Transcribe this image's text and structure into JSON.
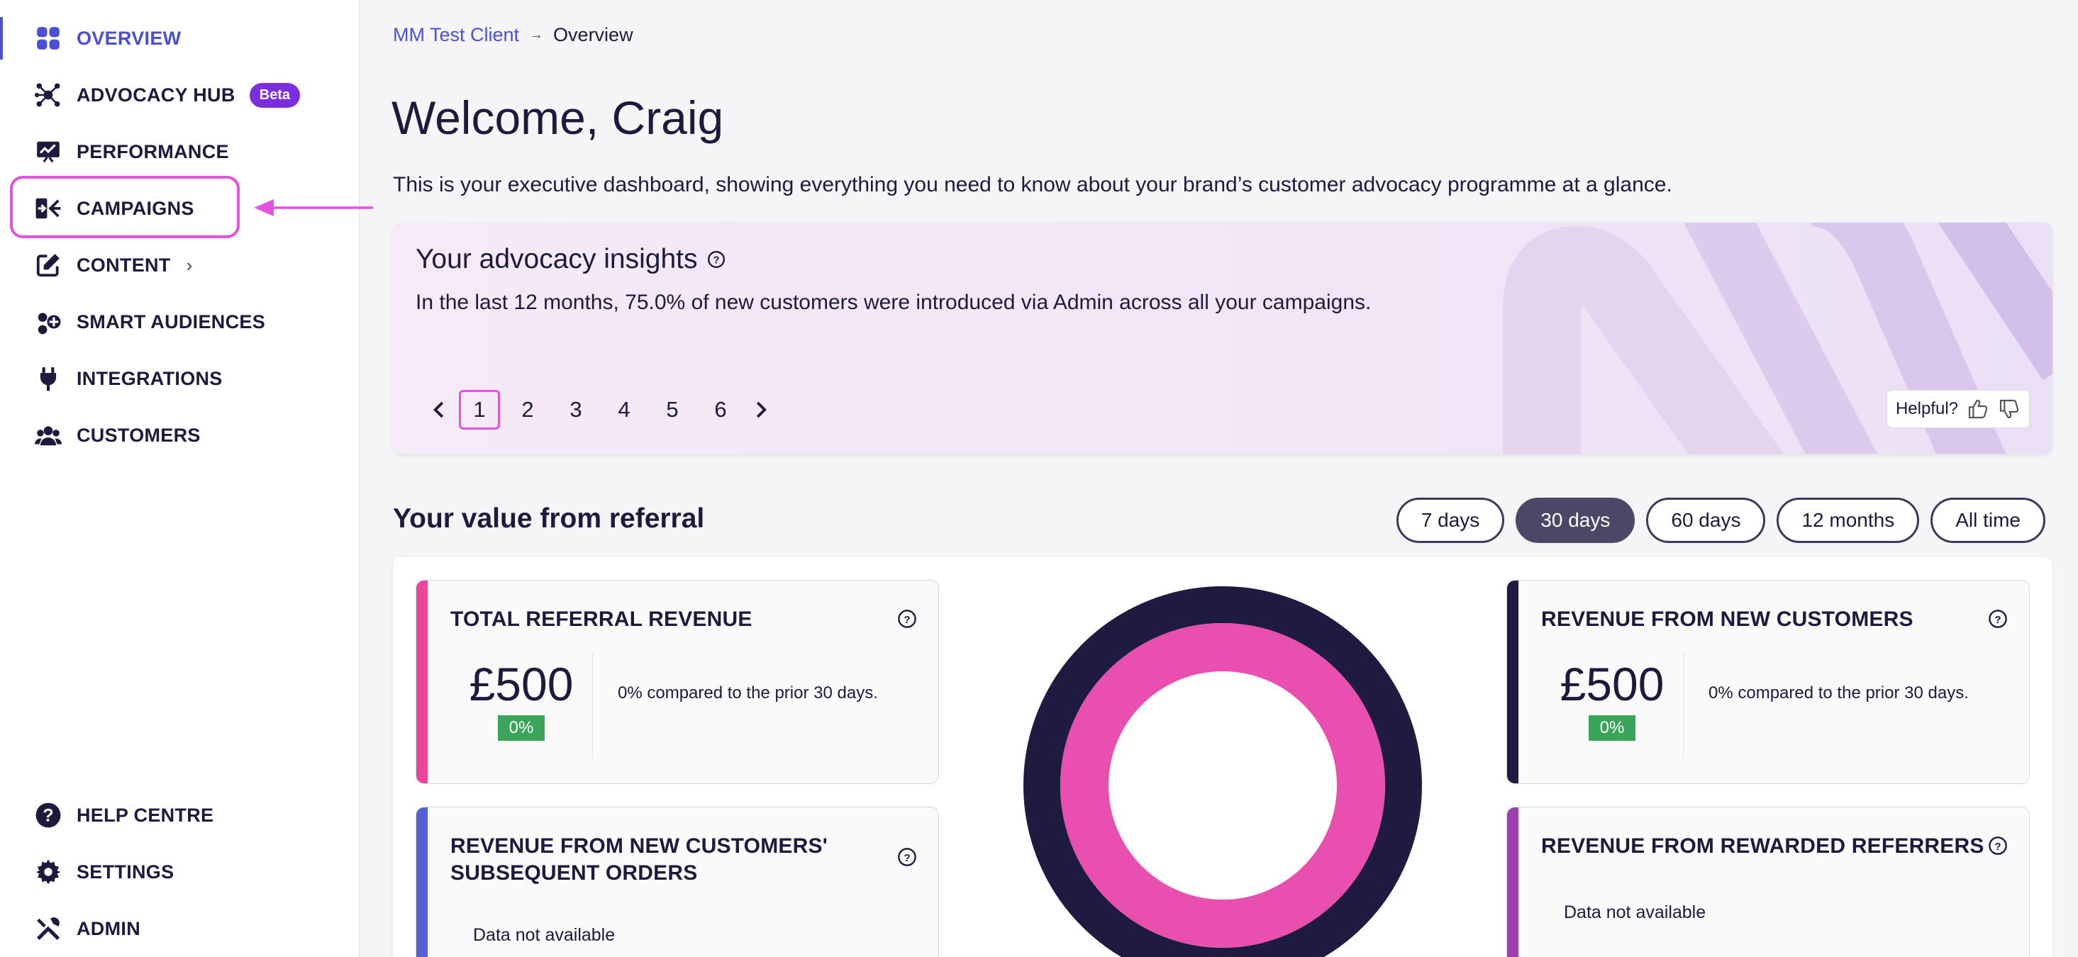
{
  "sidebar": {
    "items": [
      {
        "label": "OVERVIEW",
        "icon": "grid-icon"
      },
      {
        "label": "ADVOCACY HUB",
        "icon": "network-icon",
        "badge": "Beta"
      },
      {
        "label": "PERFORMANCE",
        "icon": "chart-icon"
      },
      {
        "label": "CAMPAIGNS",
        "icon": "campaigns-icon"
      },
      {
        "label": "CONTENT",
        "icon": "edit-icon"
      },
      {
        "label": "SMART AUDIENCES",
        "icon": "audience-icon"
      },
      {
        "label": "INTEGRATIONS",
        "icon": "plug-icon"
      },
      {
        "label": "CUSTOMERS",
        "icon": "users-icon"
      }
    ],
    "bottom_items": [
      {
        "label": "HELP CENTRE",
        "icon": "help-icon"
      },
      {
        "label": "SETTINGS",
        "icon": "gear-icon"
      },
      {
        "label": "ADMIN",
        "icon": "tools-icon"
      }
    ]
  },
  "breadcrumb": {
    "client": "MM Test Client",
    "current": "Overview"
  },
  "page": {
    "title": "Welcome, Craig",
    "intro": "This is your executive dashboard, showing everything you need to know about your brand’s customer advocacy programme at a glance."
  },
  "insights": {
    "title": "Your advocacy insights",
    "text": "In the last 12 months, 75.0% of new customers were introduced via Admin across all your campaigns.",
    "pages": [
      "1",
      "2",
      "3",
      "4",
      "5",
      "6"
    ],
    "current_page": "1",
    "helpful_label": "Helpful?"
  },
  "value": {
    "heading": "Your value from referral",
    "ranges": [
      "7 days",
      "30 days",
      "60 days",
      "12 months",
      "All time"
    ],
    "selected_range": "30 days"
  },
  "cards": {
    "total_revenue": {
      "title": "TOTAL REFERRAL REVENUE",
      "amount": "£500",
      "pct": "0%",
      "compare": "0% compared to the prior 30 days.",
      "color": "#e8459b"
    },
    "new_customers": {
      "title": "REVENUE FROM NEW CUSTOMERS",
      "amount": "£500",
      "pct": "0%",
      "compare": "0% compared to the prior 30 days.",
      "color": "#1e1a40"
    },
    "subsequent_orders": {
      "title_line1": "REVENUE FROM NEW CUSTOMERS'",
      "title_line2": "SUBSEQUENT ORDERS",
      "na": "Data not available",
      "color": "#5560d8"
    },
    "rewarded_referrers": {
      "title": "REVENUE FROM REWARDED REFERRERS",
      "na": "Data not available",
      "color": "#9b3fb0"
    }
  },
  "colors": {
    "accent": "#4b4fd6",
    "highlight": "#e452e0",
    "outer_ring": "#1e1a40",
    "inner_ring": "#e94fae",
    "positive": "#3aa55a"
  }
}
